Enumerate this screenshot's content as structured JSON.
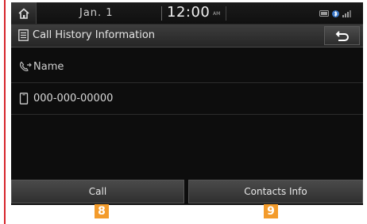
{
  "status_bar": {
    "date": "Jan.  1",
    "time": "12:00",
    "ampm": "AM",
    "home_icon": "home-icon",
    "status_icons": [
      "usb-icon",
      "bluetooth-icon",
      "signal-icon"
    ]
  },
  "title_bar": {
    "title": "Call History Information",
    "title_icon": "document-icon",
    "back_icon": "back-arrow-icon"
  },
  "details": {
    "name": "Name",
    "name_icon": "phone-handset-icon",
    "number": "000-000-00000",
    "number_icon": "mobile-phone-icon"
  },
  "buttons": {
    "call": "Call",
    "contacts_info": "Contacts Info"
  },
  "callouts": {
    "call": "8",
    "contacts_info": "9"
  },
  "colors": {
    "callout": "#f39b2b",
    "rule": "#d7262d",
    "screen_bg": "#0d0d0d"
  }
}
